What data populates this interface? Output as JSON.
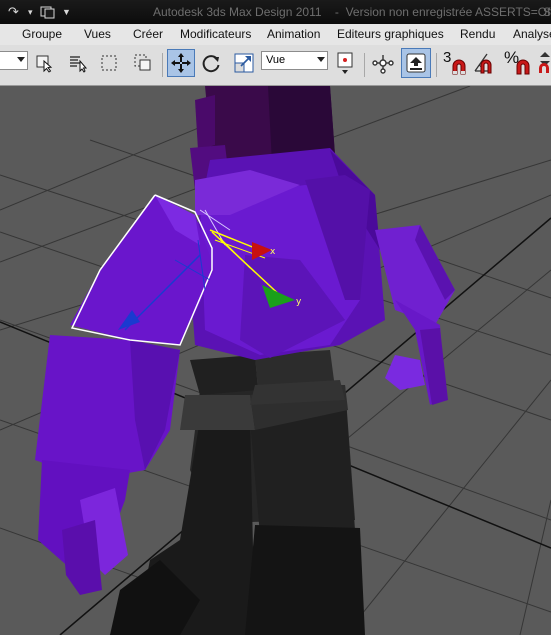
{
  "window": {
    "title": "Autodesk 3ds Max Design 2011",
    "title_suffix": "Version non enregistrée ASSERTS=Off",
    "title_separator": "-",
    "title_extra": "S"
  },
  "menu": {
    "items": [
      "Groupe",
      "Vues",
      "Créer",
      "Modificateurs",
      "Animation",
      "Editeurs graphiques",
      "Rendu",
      "Analyse"
    ]
  },
  "toolbar": {
    "view_select": "Vue",
    "snap_label": "3",
    "percent_label": "%"
  },
  "viewport": {
    "gizmo_x_label": "x",
    "gizmo_y_label": "y",
    "colors": {
      "background": "#5a5a5a",
      "grid": "#333333",
      "purple_dark": "#4a0a8e",
      "purple": "#6a12c8",
      "purple_light": "#8a2ee0",
      "black_part": "#1c1c1c",
      "selection": "#ffffff"
    }
  }
}
